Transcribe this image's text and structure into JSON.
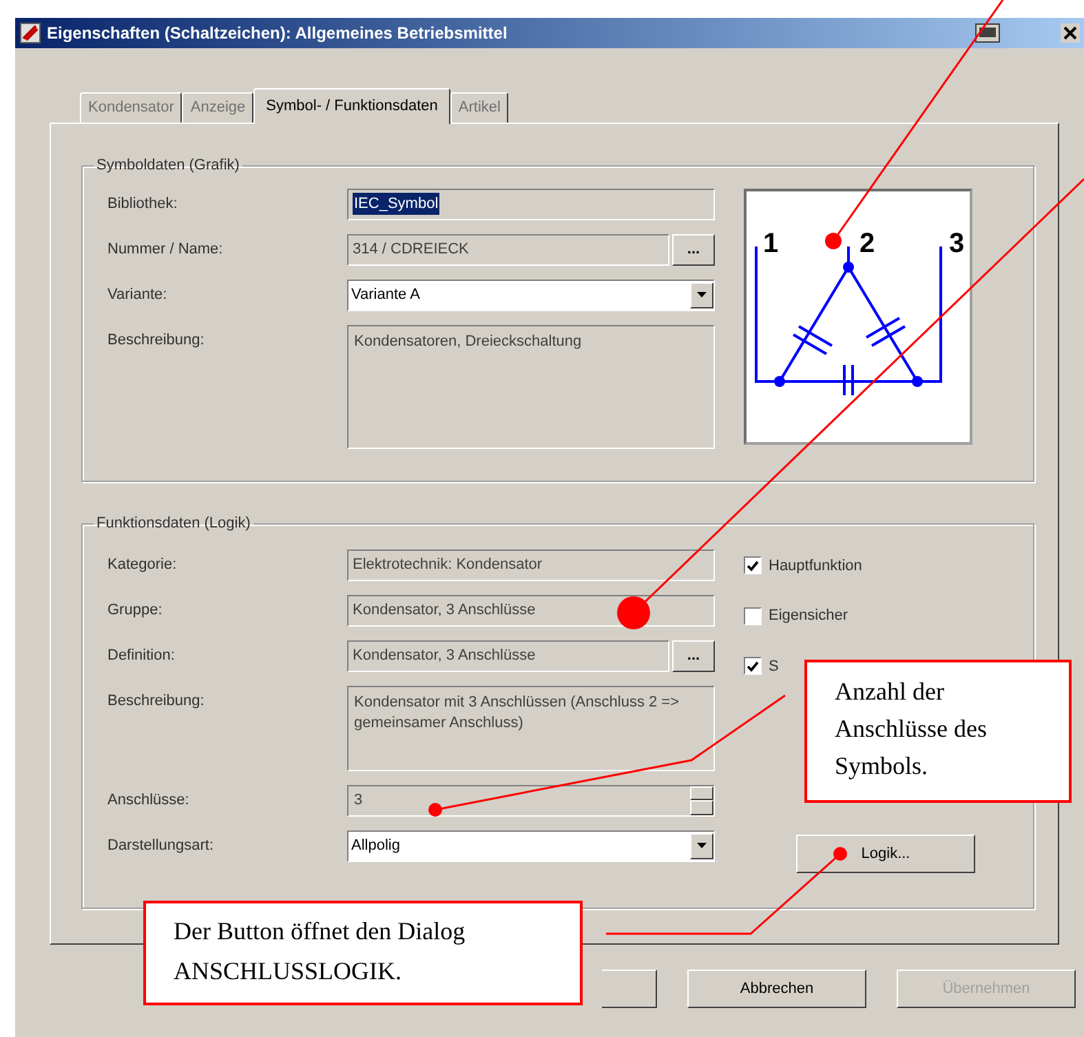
{
  "window": {
    "title": "Eigenschaften (Schaltzeichen): Allgemeines Betriebsmittel"
  },
  "tabs": [
    {
      "label": "Kondensator",
      "selected": false
    },
    {
      "label": "Anzeige",
      "selected": false
    },
    {
      "label": "Symbol- / Funktionsdaten",
      "selected": true
    },
    {
      "label": "Artikel",
      "selected": false
    }
  ],
  "symbol_group": {
    "title": "Symboldaten (Grafik)",
    "fields": [
      {
        "kind": "readonly",
        "label": "Bibliothek:",
        "value": "IEC_Symbol",
        "highlighted": true
      },
      {
        "kind": "browse",
        "label": "Nummer / Name:",
        "value": "314 / CDREIECK",
        "button": "..."
      },
      {
        "kind": "combo",
        "label": "Variante:",
        "value": "Variante A"
      },
      {
        "kind": "multiline",
        "label": "Beschreibung:",
        "value": "Kondensatoren, Dreieckschaltung"
      }
    ],
    "preview": {
      "terminals": [
        "1",
        "2",
        "3"
      ]
    }
  },
  "function_group": {
    "title": "Funktionsdaten (Logik)",
    "fields": [
      {
        "kind": "readonly",
        "label": "Kategorie:",
        "value": "Elektrotechnik: Kondensator",
        "highlighted": false
      },
      {
        "kind": "readonly",
        "label": "Gruppe:",
        "value": "Kondensator, 3 Anschlüsse",
        "highlighted": false
      },
      {
        "kind": "browse",
        "label": "Definition:",
        "value": "Kondensator, 3 Anschlüsse",
        "button": "..."
      },
      {
        "kind": "multiline",
        "label": "Beschreibung:",
        "value": "Kondensator mit 3 Anschlüssen (Anschluss 2 => gemeinsamer Anschluss)"
      },
      {
        "kind": "spin",
        "label": "Anschlüsse:",
        "value": "3"
      },
      {
        "kind": "combo",
        "label": "Darstellungsart:",
        "value": "Allpolig"
      }
    ],
    "checkboxes": [
      {
        "label": "Hauptfunktion",
        "checked": true
      },
      {
        "label": "Eigensicher",
        "checked": false
      },
      {
        "label": "S",
        "checked": true
      }
    ],
    "logic_button": "Logik..."
  },
  "buttons": [
    {
      "kind": "covered"
    },
    {
      "kind": "labeled",
      "label": "Abbrechen",
      "disabled": false
    },
    {
      "kind": "labeled",
      "label": "Übernehmen",
      "disabled": true
    }
  ],
  "callouts": [
    {
      "text": "Anzahl der Anschlüsse des Symbols."
    },
    {
      "text": "Der Button öffnet den Dialog ANSCHLUSSLOGIK."
    }
  ]
}
